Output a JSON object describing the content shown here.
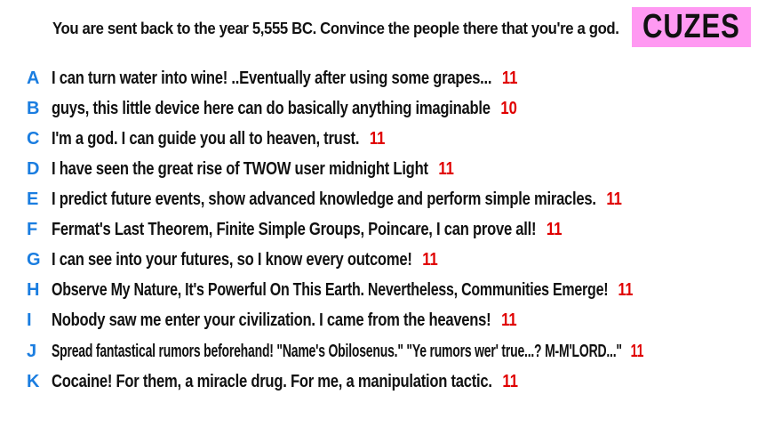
{
  "prompt": "You are sent back to the year 5,555 BC. Convince the people there that you're a god.",
  "badge": {
    "label": "CUZES",
    "color": "#ff99f2"
  },
  "colors": {
    "letter": "#1a7de0",
    "score": "#e00000",
    "text": "#111111"
  },
  "responses": [
    {
      "letter": "A",
      "text": "I can turn water into wine! ..Eventually after using some grapes...",
      "score": "11"
    },
    {
      "letter": "B",
      "text": "guys, this little device here can do basically anything imaginable",
      "score": "10"
    },
    {
      "letter": "C",
      "text": "I'm a god. I can guide you all to heaven, trust.",
      "score": "11"
    },
    {
      "letter": "D",
      "text": "I have seen the great rise of TWOW user midnight Light",
      "score": "11"
    },
    {
      "letter": "E",
      "text": "I predict future events, show advanced knowledge and perform simple miracles.",
      "score": "11"
    },
    {
      "letter": "F",
      "text": "Fermat's Last Theorem, Finite Simple Groups, Poincare, I can prove all!",
      "score": "11"
    },
    {
      "letter": "G",
      "text": "I can see into your futures, so I know every outcome!",
      "score": "11"
    },
    {
      "letter": "H",
      "text": "Observe My Nature, It's Powerful On This Earth. Nevertheless, Communities Emerge!",
      "score": "11"
    },
    {
      "letter": "I",
      "text": "Nobody saw me enter your civilization. I came from the heavens!",
      "score": "11"
    },
    {
      "letter": "J",
      "text": "Spread fantastical rumors beforehand! \"Name's Obilosenus.\" \"Ye rumors wer' true...? M-M'LORD...\"",
      "score": "11"
    },
    {
      "letter": "K",
      "text": "Cocaine! For them, a miracle drug. For me, a manipulation tactic.",
      "score": "11"
    }
  ]
}
